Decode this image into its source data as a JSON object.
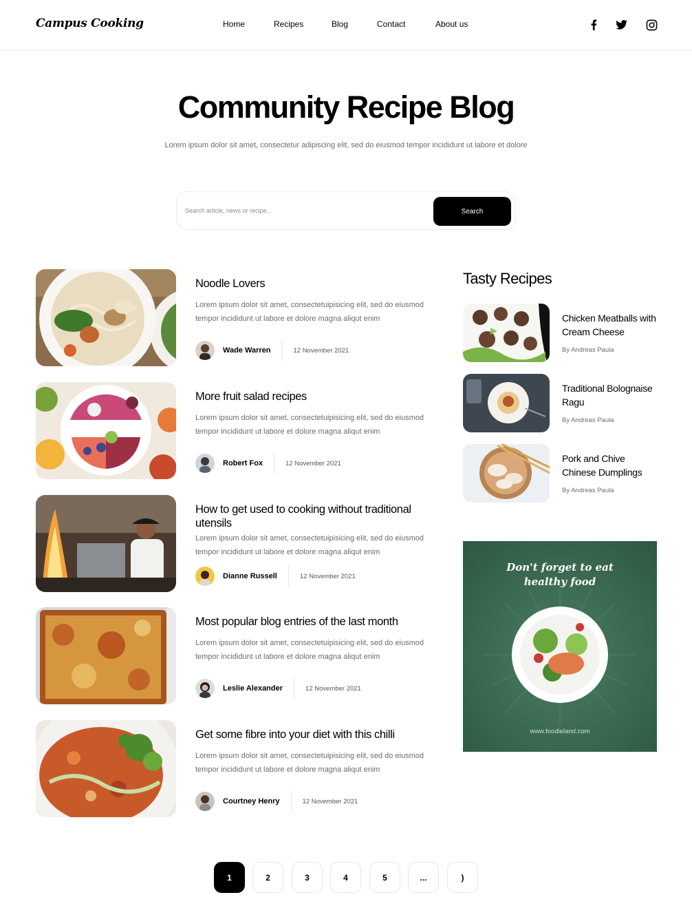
{
  "header": {
    "logo": "Campus Cooking",
    "nav": [
      "Home",
      "Recipes",
      "Blog",
      "Contact",
      "About us"
    ],
    "social_icons": [
      "facebook-icon",
      "twitter-icon",
      "instagram-icon"
    ]
  },
  "hero": {
    "title": "Community Recipe Blog",
    "subtitle": "Lorem ipsum dolor sit amet, consectetur adipiscing elit, sed do eiusmod tempor incididunt ut labore et dolore"
  },
  "search": {
    "placeholder": "Search article, news or recipe...",
    "value": "",
    "button_label": "Search"
  },
  "articles": [
    {
      "title": "Noodle Lovers",
      "body": "Lorem ipsum dolor sit amet, consectetuipisicing elit, sed do eiusmod tempor incididunt ut labore et dolore magna aliqut enim",
      "author": "Wade Warren",
      "date": "12 November 2021"
    },
    {
      "title": "More fruit salad recipes",
      "body": "Lorem ipsum dolor sit amet, consectetuipisicing elit, sed do eiusmod tempor incididunt ut labore et dolore magna aliqut enim",
      "author": "Robert Fox",
      "date": "12 November 2021"
    },
    {
      "title": "How to get used to cooking without traditional utensils",
      "body": "Lorem ipsum dolor sit amet, consectetuipisicing elit, sed do eiusmod tempor incididunt ut labore et dolore magna aliqut enim",
      "author": "Dianne Russell",
      "date": "12 November 2021"
    },
    {
      "title": "Most popular blog entries of the last month",
      "body": "Lorem ipsum dolor sit amet, consectetuipisicing elit, sed do eiusmod tempor incididunt ut labore et dolore magna aliqut enim",
      "author": "Leslie Alexander",
      "date": "12 November 2021"
    },
    {
      "title": "Get some fibre into your diet with this chilli",
      "body": "Lorem ipsum dolor sit amet, consectetuipisicing elit, sed do eiusmod tempor incididunt ut labore et dolore magna aliqut enim",
      "author": "Courtney Henry",
      "date": "12 November 2021"
    }
  ],
  "sidebar": {
    "title": "Tasty Recipes",
    "recipes": [
      {
        "title": "Chicken Meatballs with Cream Cheese",
        "by": "By Andreas Paula"
      },
      {
        "title": "Traditional Bolognaise Ragu",
        "by": "By Andreas Paula"
      },
      {
        "title": "Pork and Chive Chinese Dumplings",
        "by": "By Andreas Paula"
      }
    ],
    "ad": {
      "line1": "Don't forget to eat",
      "line2": "healthy food",
      "url": "www.foodieland.com",
      "bg_color": "#3b6b52"
    }
  },
  "pagination": {
    "pages": [
      "1",
      "2",
      "3",
      "4",
      "5",
      "...",
      ")"
    ],
    "active": "1"
  }
}
